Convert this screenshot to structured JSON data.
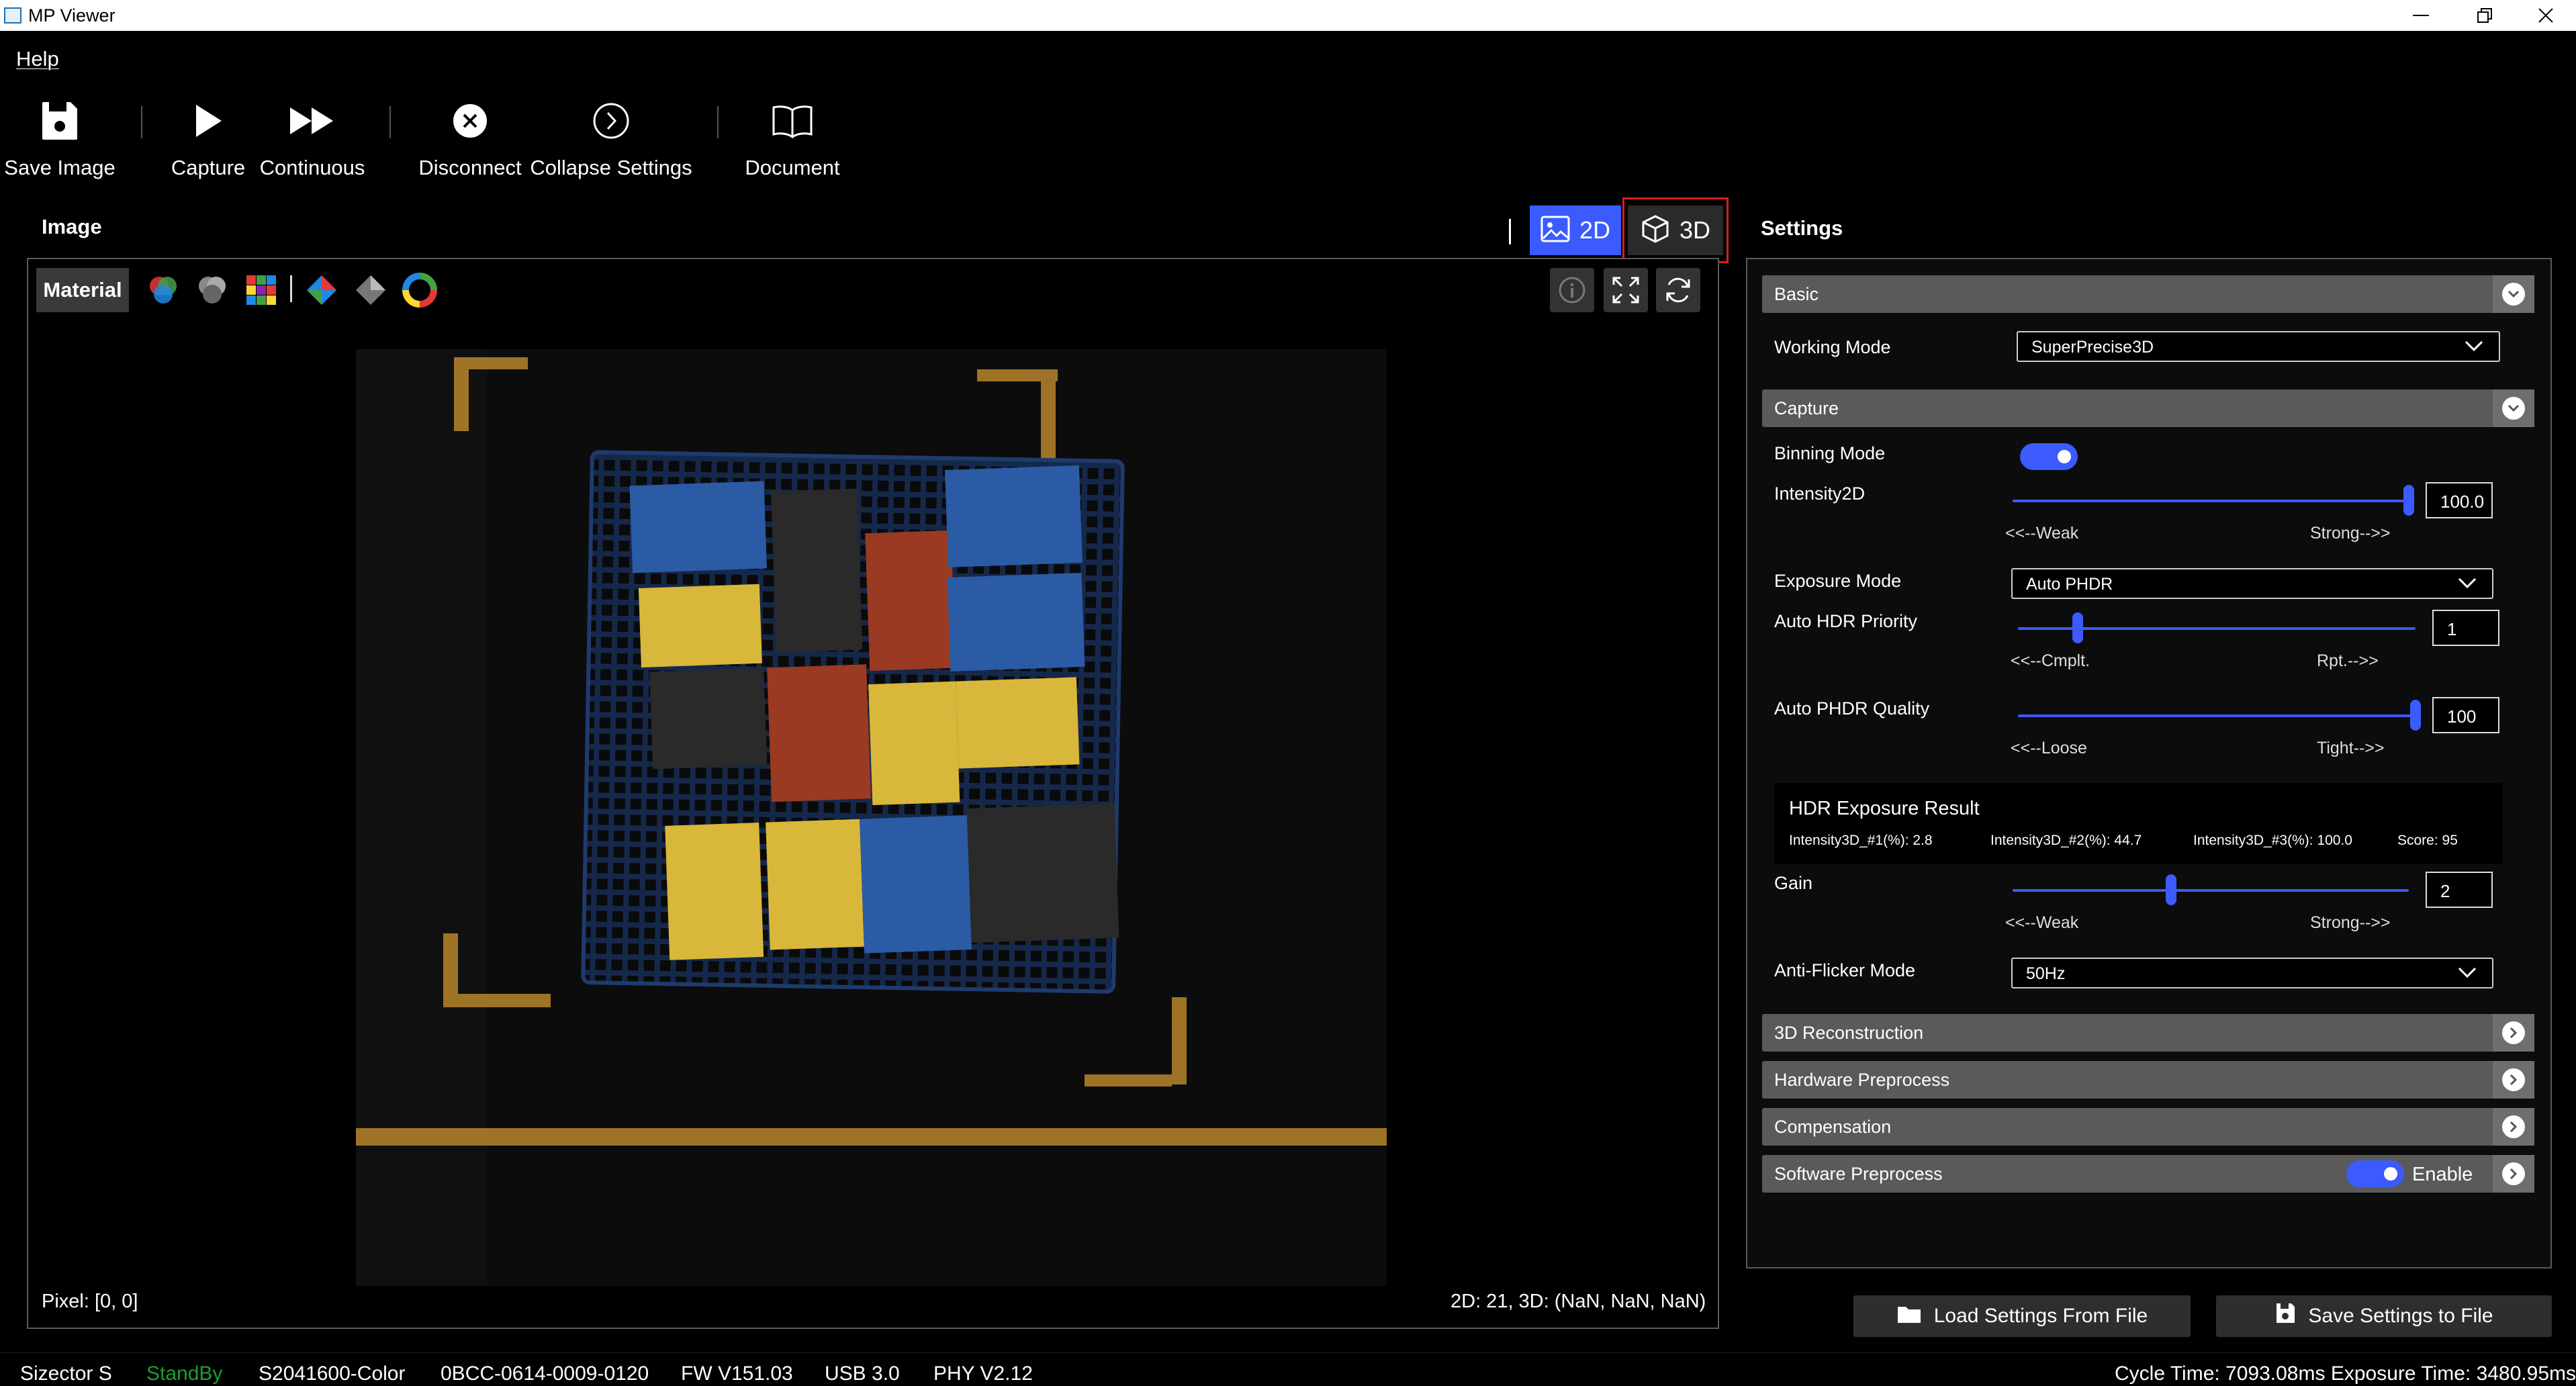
{
  "window": {
    "title": "MP Viewer"
  },
  "menu": {
    "help": "Help"
  },
  "toolbar": {
    "save_image": "Save Image",
    "capture": "Capture",
    "continuous": "Continuous",
    "disconnect": "Disconnect",
    "collapse_settings": "Collapse Settings",
    "document": "Document"
  },
  "image_panel": {
    "title": "Image",
    "mode_2d": "2D",
    "mode_3d": "3D",
    "material": "Material",
    "pixel": "Pixel: [0, 0]",
    "coords": "2D: 21, 3D: (NaN, NaN, NaN)"
  },
  "settings": {
    "title": "Settings",
    "basic": {
      "header": "Basic",
      "working_mode_label": "Working Mode",
      "working_mode_value": "SuperPrecise3D"
    },
    "capture": {
      "header": "Capture",
      "binning_mode_label": "Binning Mode",
      "binning_mode_on": true,
      "intensity2d_label": "Intensity2D",
      "intensity2d_value": "100.0",
      "intensity2d_fraction": 1.0,
      "weak": "<<--Weak",
      "strong": "Strong-->>",
      "exposure_mode_label": "Exposure Mode",
      "exposure_mode_value": "Auto PHDR",
      "auto_hdr_priority_label": "Auto HDR Priority",
      "auto_hdr_priority_value": "1",
      "auto_hdr_priority_fraction": 0.15,
      "cmplt": "<<--Cmplt.",
      "rpt": "Rpt.-->>",
      "auto_phdr_quality_label": "Auto PHDR Quality",
      "auto_phdr_quality_value": "100",
      "auto_phdr_quality_fraction": 1.0,
      "loose": "<<--Loose",
      "tight": "Tight-->>",
      "hdr_result_title": "HDR Exposure Result",
      "hdr_r1": "Intensity3D_#1(%): 2.8",
      "hdr_r2": "Intensity3D_#2(%): 44.7",
      "hdr_r3": "Intensity3D_#3(%): 100.0",
      "hdr_score": "Score: 95",
      "gain_label": "Gain",
      "gain_value": "2",
      "gain_fraction": 0.4,
      "anti_flicker_label": "Anti-Flicker Mode",
      "anti_flicker_value": "50Hz"
    },
    "sections": [
      "3D Reconstruction",
      "Hardware Preprocess",
      "Compensation",
      "Software Preprocess"
    ],
    "software_enable": "Enable",
    "load_btn": "Load Settings From File",
    "save_btn": "Save Settings to File"
  },
  "status": {
    "model": "Sizector S",
    "state": "StandBy",
    "sensor": "S2041600-Color",
    "serial": "0BCC-0614-0009-0120",
    "fw": "FW V151.03",
    "usb": "USB 3.0",
    "phy": "PHY V2.12",
    "timing": "Cycle Time: 7093.08ms Exposure Time: 3480.95ms"
  },
  "colors": {
    "accent": "#3b5bff",
    "standby": "#1e9e2e",
    "tape": "#b8862c",
    "highlight": "#d81e1e"
  }
}
